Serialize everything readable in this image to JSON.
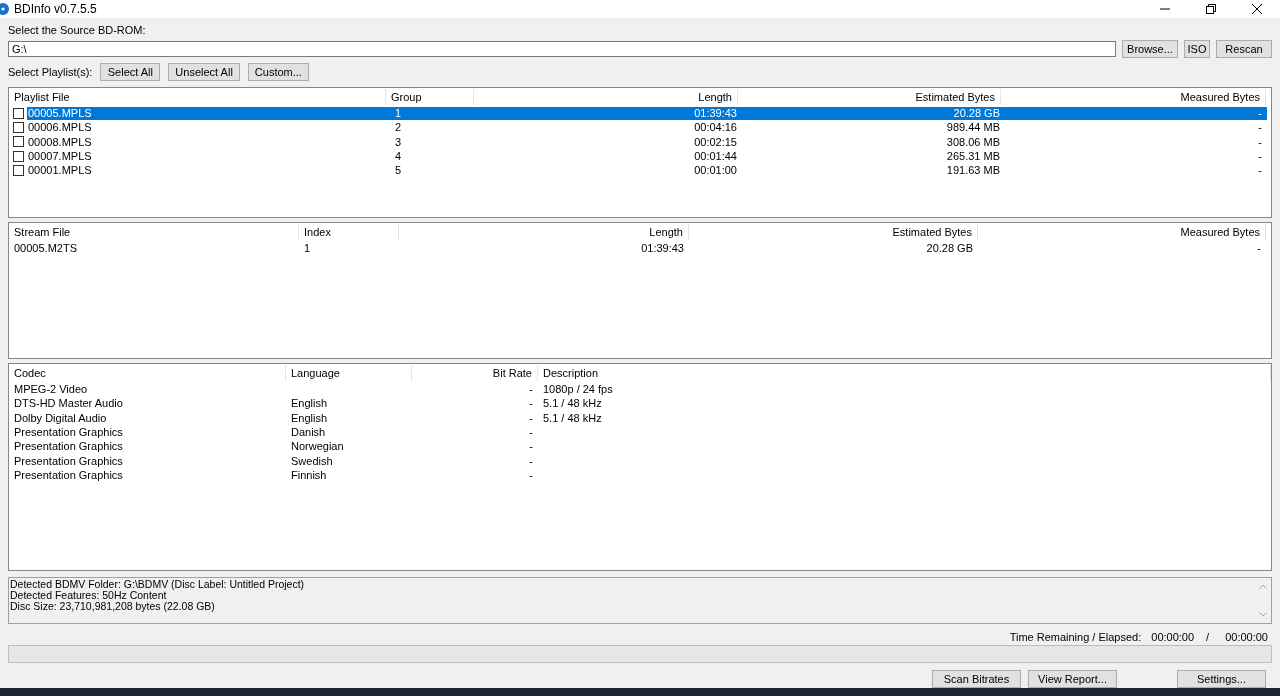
{
  "window": {
    "title": "BDInfo v0.7.5.5"
  },
  "source": {
    "label": "Select the Source BD-ROM:",
    "value": "G:\\",
    "buttons": [
      "Browse...",
      "ISO",
      "Rescan"
    ]
  },
  "playlist_bar": {
    "label": "Select Playlist(s):",
    "buttons": [
      "Select All",
      "Unselect All",
      "Custom..."
    ]
  },
  "playlists": {
    "columns": [
      "Playlist File",
      "Group",
      "Length",
      "Estimated Bytes",
      "Measured Bytes"
    ],
    "rows": [
      {
        "file": "00005.MPLS",
        "group": "1",
        "length": "01:39:43",
        "estimated": "20.28 GB",
        "measured": "-",
        "checked": false,
        "selected": true
      },
      {
        "file": "00006.MPLS",
        "group": "2",
        "length": "00:04:16",
        "estimated": "989.44 MB",
        "measured": "-",
        "checked": false,
        "selected": false
      },
      {
        "file": "00008.MPLS",
        "group": "3",
        "length": "00:02:15",
        "estimated": "308.06 MB",
        "measured": "-",
        "checked": false,
        "selected": false
      },
      {
        "file": "00007.MPLS",
        "group": "4",
        "length": "00:01:44",
        "estimated": "265.31 MB",
        "measured": "-",
        "checked": false,
        "selected": false
      },
      {
        "file": "00001.MPLS",
        "group": "5",
        "length": "00:01:00",
        "estimated": "191.63 MB",
        "measured": "-",
        "checked": false,
        "selected": false
      }
    ]
  },
  "streams": {
    "columns": [
      "Stream File",
      "Index",
      "Length",
      "Estimated Bytes",
      "Measured Bytes"
    ],
    "rows": [
      {
        "file": "00005.M2TS",
        "index": "1",
        "length": "01:39:43",
        "estimated": "20.28 GB",
        "measured": "-"
      }
    ]
  },
  "codecs": {
    "columns": [
      "Codec",
      "Language",
      "Bit Rate",
      "Description"
    ],
    "rows": [
      {
        "codec": "MPEG-2 Video",
        "language": "",
        "bitrate": "-",
        "description": "1080p / 24 fps"
      },
      {
        "codec": "DTS-HD Master Audio",
        "language": "English",
        "bitrate": "-",
        "description": "5.1 / 48 kHz"
      },
      {
        "codec": "Dolby Digital Audio",
        "language": "English",
        "bitrate": "-",
        "description": "5.1 / 48 kHz"
      },
      {
        "codec": "Presentation Graphics",
        "language": "Danish",
        "bitrate": "-",
        "description": ""
      },
      {
        "codec": "Presentation Graphics",
        "language": "Norwegian",
        "bitrate": "-",
        "description": ""
      },
      {
        "codec": "Presentation Graphics",
        "language": "Swedish",
        "bitrate": "-",
        "description": ""
      },
      {
        "codec": "Presentation Graphics",
        "language": "Finnish",
        "bitrate": "-",
        "description": ""
      }
    ]
  },
  "log": [
    "Detected BDMV Folder: G:\\BDMV (Disc Label: Untitled Project)",
    "Detected Features: 50Hz Content",
    "Disc Size: 23,710,981,208 bytes (22.08 GB)"
  ],
  "timer": {
    "label": "Time Remaining / Elapsed:",
    "remaining": "00:00:00",
    "separator": "/",
    "elapsed": "00:00:00"
  },
  "progress": {
    "level": 0
  },
  "bottom_buttons": [
    "Scan Bitrates",
    "View Report...",
    "Settings..."
  ]
}
